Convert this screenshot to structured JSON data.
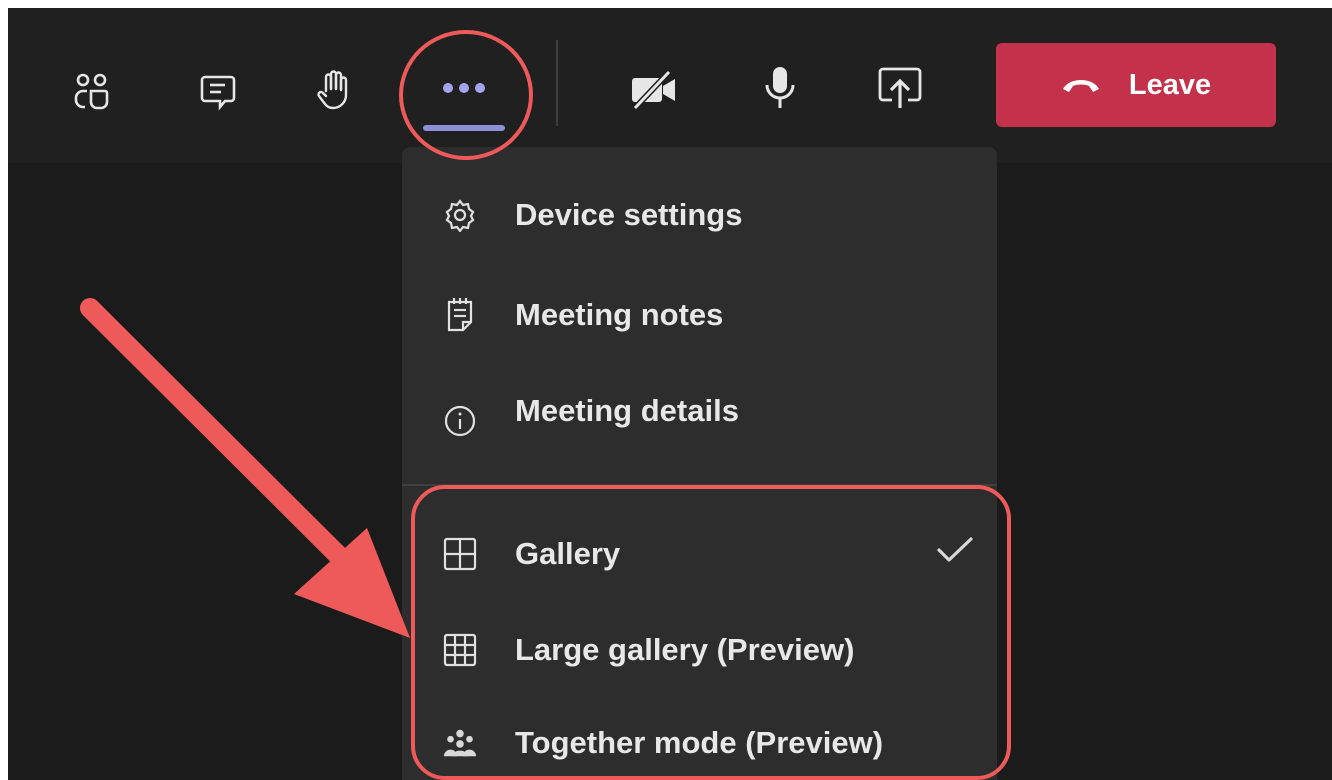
{
  "toolbar": {
    "items": [
      {
        "name": "participants-icon"
      },
      {
        "name": "chat-icon"
      },
      {
        "name": "raise-hand-icon"
      },
      {
        "name": "more-actions-icon"
      },
      {
        "name": "camera-off-icon"
      },
      {
        "name": "microphone-icon"
      },
      {
        "name": "share-screen-icon"
      }
    ],
    "leave_label": "Leave",
    "leave_color": "#c4314b",
    "active_underline_color": "#8f8fd8"
  },
  "menu": {
    "items": [
      {
        "label": "Device settings",
        "icon": "gear-icon"
      },
      {
        "label": "Meeting notes",
        "icon": "notes-icon"
      },
      {
        "label": "Meeting details",
        "icon": "info-icon"
      },
      {
        "label": "Gallery",
        "icon": "grid-2x2-icon",
        "checked": true
      },
      {
        "label": "Large gallery (Preview)",
        "icon": "grid-3x3-icon"
      },
      {
        "label": "Together mode (Preview)",
        "icon": "people-group-icon"
      }
    ]
  },
  "annotation": {
    "highlight_color": "#ee5a5a"
  }
}
